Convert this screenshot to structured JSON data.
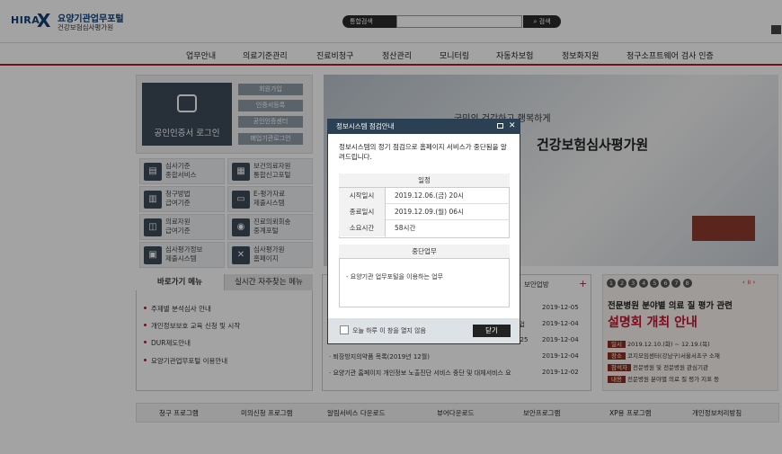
{
  "header": {
    "logo_en": "HIRA",
    "logo_mark": "X",
    "portal_title": "요양기관업무포털",
    "org_name": "건강보험심사평가원",
    "search_select": "통합검색",
    "search_placeholder": "",
    "search_button": "검색"
  },
  "nav": {
    "items": [
      "업무안내",
      "의료기준관리",
      "진료비청구",
      "정산관리",
      "모니터링",
      "자동차보험",
      "정보화지원",
      "청구소프트웨어 검사 인증"
    ]
  },
  "login": {
    "cert_button": "공인인증서 로그인",
    "side_buttons": [
      "회원가입",
      "인증서등록",
      "공인인증센터",
      "폐업기관로그인"
    ]
  },
  "services": [
    {
      "line1": "심사기준",
      "line2": "종합서비스"
    },
    {
      "line1": "보건의료자원",
      "line2": "통합신고포털"
    },
    {
      "line1": "청구방법",
      "line2": "급여기준"
    },
    {
      "line1": "E-평가자료",
      "line2": "제출시스템"
    },
    {
      "line1": "의료자원",
      "line2": "급여기준"
    },
    {
      "line1": "진료의뢰회송",
      "line2": "중계포털"
    },
    {
      "line1": "심사평가정보",
      "line2": "제출시스템"
    },
    {
      "line1": "심사평가원",
      "line2": "홈페이지"
    }
  ],
  "banner": {
    "slogan": "국민의 건강하고 행복하게",
    "org": "건강보험심사평가원"
  },
  "quick": {
    "tab1": "바로가기 메뉴",
    "tab2": "실시간 자주찾는 메뉴",
    "items": [
      "주제별 분석심사 안내",
      "개인정보보호 교육 신청 및 시작",
      "DUR제도안내",
      "요양기관업무포털 이용안내"
    ]
  },
  "notice": {
    "title_right": "보안업방",
    "plus": "+",
    "rows": [
      {
        "text": "",
        "date": "2019-12-05"
      },
      {
        "text": "사업",
        "date": "2019-12-04"
      },
      {
        "text": "-25",
        "date": "2019-12-04"
      },
      {
        "text": "· 퇴장방지의약품 목록(2019년 12월)",
        "date": "2019-12-04"
      },
      {
        "text": "· 요양기관 홈페이지 개인정보 노출진단 서비스 중단 및 대체서비스 요",
        "date": "2019-12-02"
      }
    ]
  },
  "rbanner": {
    "pages": [
      "1",
      "2",
      "3",
      "4",
      "5",
      "6",
      "7",
      "8"
    ],
    "headline1": "전문병원 분야별 의료 질 평가 관련",
    "headline2": "설명회 개최 안내",
    "rows": [
      {
        "k": "일시",
        "v": "2019.12.10.(화) ~ 12.19.(목)"
      },
      {
        "k": "장소",
        "v": "코지모임센터(강남구)서울서초구 소재"
      },
      {
        "k": "참석자",
        "v": "전문병원 및 전문병원 관심기관"
      },
      {
        "k": "내용",
        "v": "전문병원 분야별 의료 질 평가 지표 등"
      }
    ]
  },
  "bottom": {
    "items": [
      "청구 프로그램",
      "미의신청 프로그램",
      "알림서비스 다운로드",
      "뷰어다운로드",
      "보안프로그램",
      "XP용 프로그램",
      "개인정보처리방침"
    ]
  },
  "popup": {
    "title": "정보시스템 점검안내",
    "message": "정보시스템의 정기 점검으로 홈페이지 서비스가 중단됨을 알려드립니다.",
    "schedule_header": "일정",
    "rows": [
      {
        "k": "시작일시",
        "v": "2019.12.06.(금) 20시"
      },
      {
        "k": "종료일시",
        "v": "2019.12.09.(월) 06시"
      },
      {
        "k": "소요시간",
        "v": "58시간"
      }
    ],
    "job_header": "중단업무",
    "job_text": "- 요양기관 업무포털을 이용하는 업무",
    "checkbox_label": "오늘 하루 이 창을 열지 않음",
    "close_button": "닫기"
  }
}
